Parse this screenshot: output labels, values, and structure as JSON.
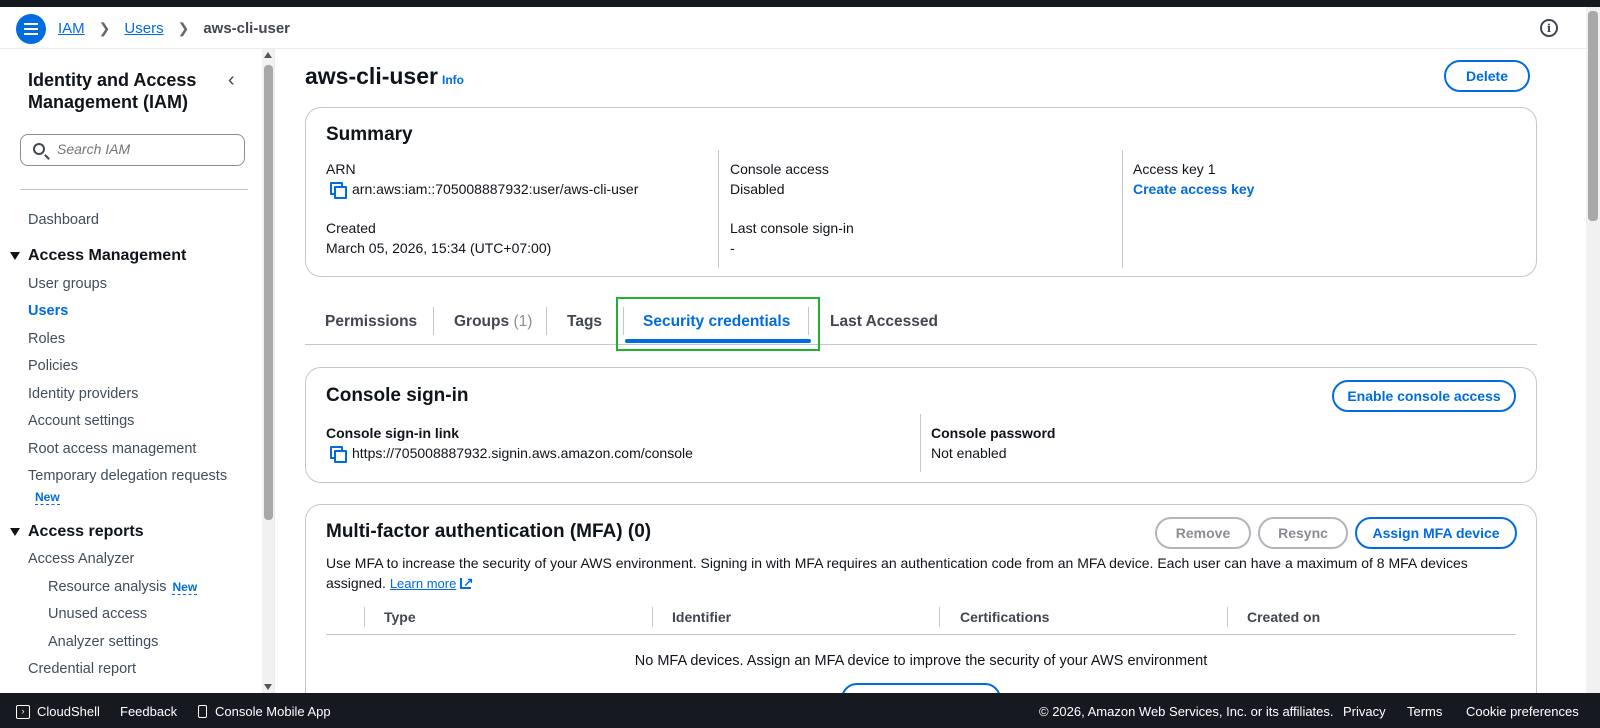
{
  "breadcrumb": {
    "root": "IAM",
    "parent": "Users",
    "current": "aws-cli-user"
  },
  "sidebar": {
    "title": "Identity and Access Management (IAM)",
    "search_placeholder": "Search IAM",
    "dashboard": "Dashboard",
    "access_management": {
      "heading": "Access Management",
      "items": [
        "User groups",
        "Users",
        "Roles",
        "Policies",
        "Identity providers",
        "Account settings",
        "Root access management",
        "Temporary delegation requests"
      ],
      "new_badge": "New"
    },
    "access_reports": {
      "heading": "Access reports",
      "analyzer": "Access Analyzer",
      "resource_analysis": "Resource analysis",
      "new_badge": "New",
      "unused_access": "Unused access",
      "analyzer_settings": "Analyzer settings",
      "credential_report": "Credential report"
    }
  },
  "page": {
    "title": "aws-cli-user",
    "info": "Info",
    "delete_label": "Delete"
  },
  "summary": {
    "title": "Summary",
    "arn_label": "ARN",
    "arn_value": "arn:aws:iam::705008887932:user/aws-cli-user",
    "created_label": "Created",
    "created_value": "March 05, 2026, 15:34 (UTC+07:00)",
    "console_access_label": "Console access",
    "console_access_value": "Disabled",
    "last_signin_label": "Last console sign-in",
    "last_signin_value": "-",
    "access_key_label": "Access key 1",
    "access_key_link": "Create access key"
  },
  "tabs": {
    "permissions": "Permissions",
    "groups": "Groups",
    "groups_count": "(1)",
    "tags": "Tags",
    "security_credentials": "Security credentials",
    "last_accessed": "Last Accessed"
  },
  "console_signin": {
    "title": "Console sign-in",
    "enable_button": "Enable console access",
    "link_label": "Console sign-in link",
    "link_value": "https://705008887932.signin.aws.amazon.com/console",
    "password_label": "Console password",
    "password_value": "Not enabled"
  },
  "mfa": {
    "title": "Multi-factor authentication (MFA) (0)",
    "remove_button": "Remove",
    "resync_button": "Resync",
    "assign_button": "Assign MFA device",
    "description": "Use MFA to increase the security of your AWS environment. Signing in with MFA requires an authentication code from an MFA device. Each user can have a maximum of 8 MFA devices assigned.",
    "learn_more": "Learn more",
    "columns": [
      "Type",
      "Identifier",
      "Certifications",
      "Created on"
    ],
    "empty_text": "No MFA devices. Assign an MFA device to improve the security of your AWS environment"
  },
  "footer": {
    "cloudshell": "CloudShell",
    "feedback": "Feedback",
    "mobile_app": "Console Mobile App",
    "copyright": "© 2026, Amazon Web Services, Inc. or its affiliates.",
    "privacy": "Privacy",
    "terms": "Terms",
    "cookies": "Cookie preferences"
  }
}
